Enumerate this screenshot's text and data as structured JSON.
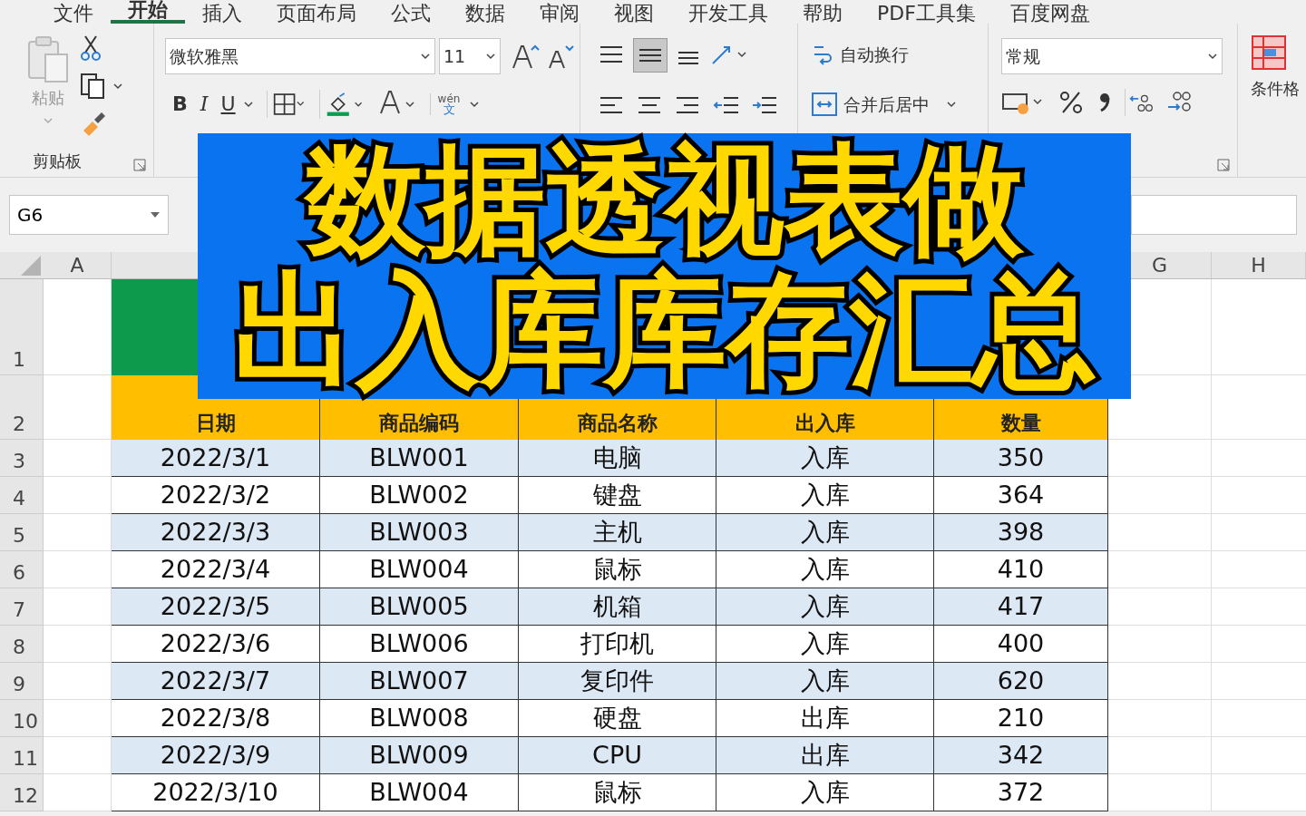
{
  "ribbon_tabs": [
    {
      "label": "文件",
      "selected": false
    },
    {
      "label": "开始",
      "selected": true
    },
    {
      "label": "插入",
      "selected": false
    },
    {
      "label": "页面布局",
      "selected": false
    },
    {
      "label": "公式",
      "selected": false
    },
    {
      "label": "数据",
      "selected": false
    },
    {
      "label": "审阅",
      "selected": false
    },
    {
      "label": "视图",
      "selected": false
    },
    {
      "label": "开发工具",
      "selected": false
    },
    {
      "label": "帮助",
      "selected": false
    },
    {
      "label": "PDF工具集",
      "selected": false
    },
    {
      "label": "百度网盘",
      "selected": false
    }
  ],
  "clipboard": {
    "paste": "粘贴",
    "group": "剪贴板"
  },
  "font": {
    "name": "微软雅黑",
    "size": "11",
    "bold": "B",
    "italic": "I",
    "underline": "U",
    "phonetic_top": "wén",
    "phonetic_bottom": "文"
  },
  "alignment": {
    "wrap": "自动换行",
    "merge": "合并后居中"
  },
  "number": {
    "format": "常规"
  },
  "styles": {
    "conditional": "条件格"
  },
  "name_box": "G6",
  "columns": [
    "A",
    "G",
    "H"
  ],
  "overlay_title": [
    "数据透视表做",
    "出入库库存汇总"
  ],
  "table": {
    "header": [
      "日期",
      "商品编码",
      "商品名称",
      "出入库",
      "数量"
    ],
    "rows": [
      {
        "row": "3",
        "cells": [
          "2022/3/1",
          "BLW001",
          "电脑",
          "入库",
          "350"
        ]
      },
      {
        "row": "4",
        "cells": [
          "2022/3/2",
          "BLW002",
          "键盘",
          "入库",
          "364"
        ]
      },
      {
        "row": "5",
        "cells": [
          "2022/3/3",
          "BLW003",
          "主机",
          "入库",
          "398"
        ]
      },
      {
        "row": "6",
        "cells": [
          "2022/3/4",
          "BLW004",
          "鼠标",
          "入库",
          "410"
        ]
      },
      {
        "row": "7",
        "cells": [
          "2022/3/5",
          "BLW005",
          "机箱",
          "入库",
          "417"
        ]
      },
      {
        "row": "8",
        "cells": [
          "2022/3/6",
          "BLW006",
          "打印机",
          "入库",
          "400"
        ]
      },
      {
        "row": "9",
        "cells": [
          "2022/3/7",
          "BLW007",
          "复印件",
          "入库",
          "620"
        ]
      },
      {
        "row": "10",
        "cells": [
          "2022/3/8",
          "BLW008",
          "硬盘",
          "出库",
          "210"
        ]
      },
      {
        "row": "11",
        "cells": [
          "2022/3/9",
          "BLW009",
          "CPU",
          "出库",
          "342"
        ]
      },
      {
        "row": "12",
        "cells": [
          "2022/3/10",
          "BLW004",
          "鼠标",
          "入库",
          "372"
        ]
      }
    ]
  },
  "row_numbers": [
    "1",
    "2"
  ]
}
